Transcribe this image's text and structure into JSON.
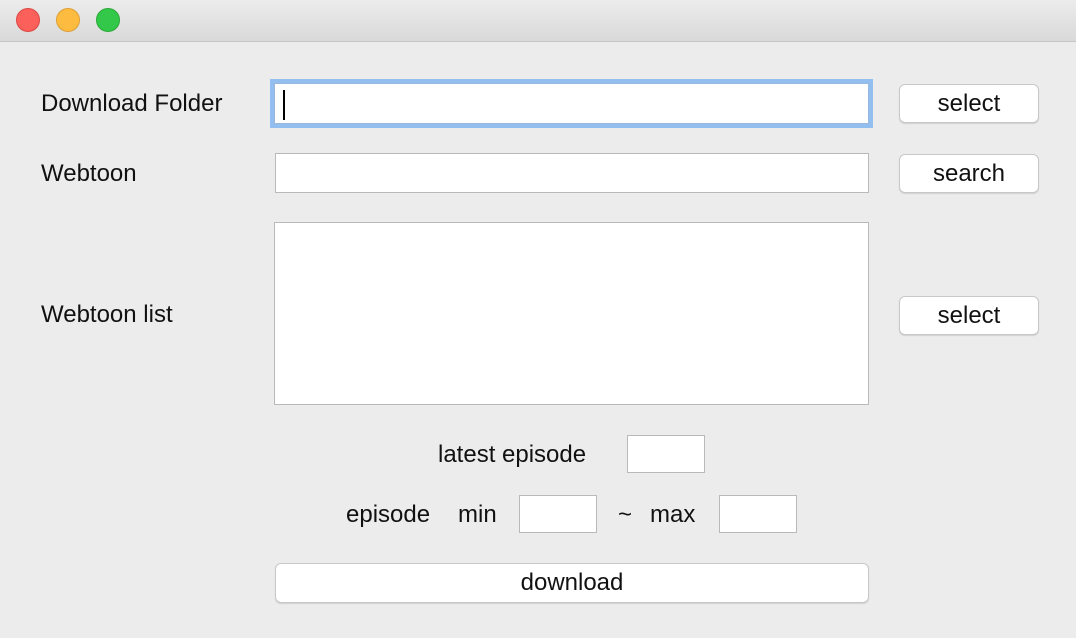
{
  "window": {
    "traffic_lights": [
      "close",
      "minimize",
      "maximize"
    ],
    "colors": {
      "close": "#fc605b",
      "minimize": "#fdbc40",
      "maximize": "#34c84a",
      "focus_ring": "#92bff0"
    }
  },
  "form": {
    "download_folder": {
      "label": "Download Folder",
      "value": "",
      "button": "select"
    },
    "webtoon": {
      "label": "Webtoon",
      "value": "",
      "button": "search"
    },
    "webtoon_list": {
      "label": "Webtoon list",
      "items": [],
      "button": "select"
    },
    "latest_episode": {
      "label": "latest episode",
      "value": ""
    },
    "episode": {
      "label": "episode",
      "min_label": "min",
      "min_value": "",
      "separator": "~",
      "max_label": "max",
      "max_value": ""
    },
    "download_button": "download"
  }
}
